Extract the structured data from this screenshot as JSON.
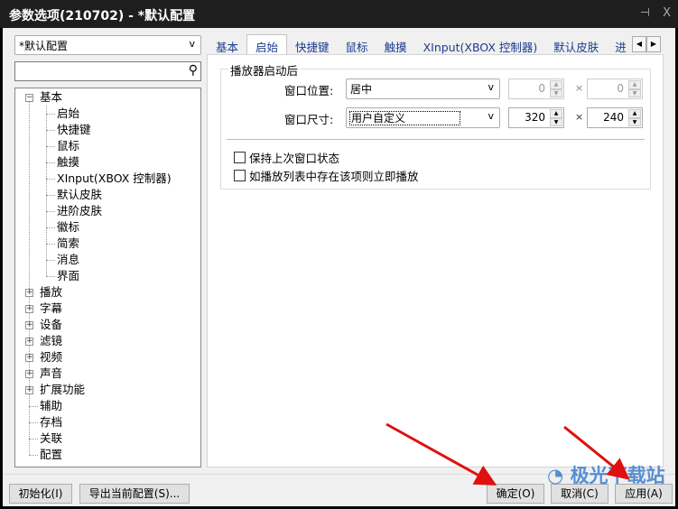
{
  "window": {
    "title": "参数选项(210702) - *默认配置",
    "pin_icon": "pin-icon",
    "close_label": "X"
  },
  "profile": {
    "selected": "*默认配置",
    "arrow": "v"
  },
  "search": {
    "value": "",
    "placeholder": ""
  },
  "tree": {
    "root": {
      "label": "基本",
      "expanded": true,
      "children": [
        "启始",
        "快捷键",
        "鼠标",
        "触摸",
        "XInput(XBOX 控制器)",
        "默认皮肤",
        "进阶皮肤",
        "徽标",
        "简索",
        "消息",
        "界面"
      ]
    },
    "others": [
      {
        "label": "播放",
        "expandable": true
      },
      {
        "label": "字幕",
        "expandable": true
      },
      {
        "label": "设备",
        "expandable": true
      },
      {
        "label": "滤镜",
        "expandable": true
      },
      {
        "label": "视频",
        "expandable": true
      },
      {
        "label": "声音",
        "expandable": true
      },
      {
        "label": "扩展功能",
        "expandable": true
      },
      {
        "label": "辅助",
        "expandable": false
      },
      {
        "label": "存档",
        "expandable": false
      },
      {
        "label": "关联",
        "expandable": false
      },
      {
        "label": "配置",
        "expandable": false
      }
    ]
  },
  "tabs": [
    "基本",
    "启始",
    "快捷键",
    "鼠标",
    "触摸",
    "XInput(XBOX 控制器)",
    "默认皮肤",
    "进"
  ],
  "active_tab": "启始",
  "startup": {
    "group_title": "播放器启动后",
    "position_label": "窗口位置:",
    "position_value": "居中",
    "pos_x": "0",
    "pos_y": "0",
    "size_label": "窗口尺寸:",
    "size_value": "用户自定义",
    "width": "320",
    "height": "240",
    "times": "×",
    "keep_state": {
      "label": "保持上次窗口状态",
      "checked": false
    },
    "play_if_in_list": {
      "label": "如播放列表中存在该项则立即播放",
      "checked": false
    }
  },
  "buttons": {
    "init": "初始化(I)",
    "export": "导出当前配置(S)...",
    "ok": "确定(O)",
    "cancel": "取消(C)",
    "apply": "应用(A)"
  },
  "watermark": "极光下载站",
  "colors": {
    "titlebar": "#1e1e1e",
    "tab_text": "#1a3d8f",
    "arrow": "#e01010"
  }
}
